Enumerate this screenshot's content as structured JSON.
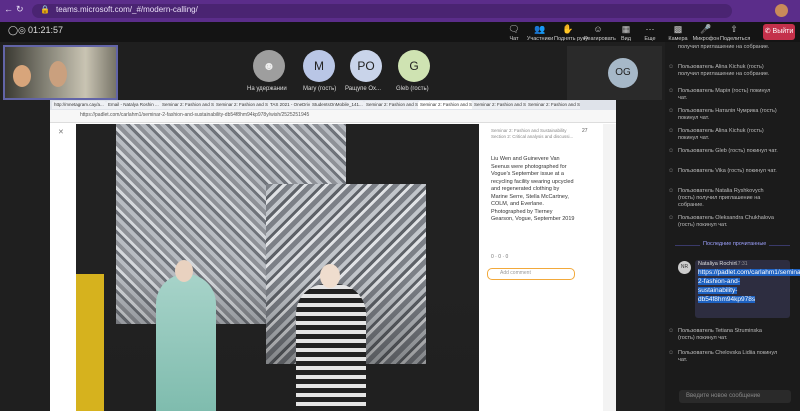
{
  "browser": {
    "url": "teams.microsoft.com/_#/modern-calling/"
  },
  "meeting": {
    "timer": "01:21:57",
    "toolbar": [
      {
        "icon": "chat-icon",
        "label": "Чат"
      },
      {
        "icon": "people-icon",
        "label": "Участники"
      },
      {
        "icon": "raise-hand-icon",
        "label": "Поднять руку"
      },
      {
        "icon": "react-icon",
        "label": "Реагировать"
      },
      {
        "icon": "view-icon",
        "label": "Вид"
      },
      {
        "icon": "more-icon",
        "label": "Еще"
      },
      {
        "icon": "camera-icon",
        "label": "Камера"
      },
      {
        "icon": "mic-icon",
        "label": "Микрофон"
      },
      {
        "icon": "share-icon",
        "label": "Поделиться"
      }
    ],
    "leave": "Выйти"
  },
  "participants": [
    {
      "initials": "",
      "name": "На удержании",
      "color": "#9e9e9e"
    },
    {
      "initials": "M",
      "name": "Mary (гость)",
      "color": "#b9c6e6"
    },
    {
      "initials": "PO",
      "name": "Ращупе Ох...",
      "color": "#c9d4ea"
    },
    {
      "initials": "G",
      "name": "Gleb (гость)",
      "color": "#cfe3b2"
    }
  ],
  "og_initials": "OG",
  "shared": {
    "tabs": [
      "http://mnetagram.cay/a...",
      "Email - Natalya Roshin ...",
      "Seminar 2: Fashion and S...",
      "Seminar 2: Fashion and S...",
      "TAS 2021 - OneDrive",
      "StudentsOnMobile_141...",
      "Seminar 2: Fashion and S...",
      "Seminar 2: Fashion and Su...",
      "Seminar 2: Fashion and Su...",
      "Seminar 2: Fashion and Su..."
    ],
    "url": "https://padlet.com/carlahm1/seminar-2-fashion-and-sustainability-db54f8hm94kp978y/wish/2525251945",
    "section": "Seminar 2: Fashion and Sustainability",
    "section2": "Section 2: Critical analysis and discussi...",
    "count": "27",
    "caption": "Liu Wen and Guinevere Van Seenus were photographed for Vogue's September issue at a recycling facility wearing upcycled and regenerated clothing by Marine Serre, Stella McCartney, COLM, and Everlane. Photographed by Tierney Gearson, Vogue, September 2019",
    "stats": "0 · 0 · 0",
    "comment_placeholder": "Add comment"
  },
  "chat": {
    "messages": [
      "получил приглашение на собрание.",
      "Пользователь Alina Kichuk (гость) получил приглашение на собрание.",
      "Пользователь Марія (гость) покинул чат.",
      "Пользователь Наталія Чумрика (гость) покинул чат.",
      "Пользователь Alina Kichuk (гость) покинул чат.",
      "Пользователь Gleb (гость) покинул чат.",
      "Пользователь Vika (гость) покинул чат.",
      "Пользователь Natalia Ryshkovych (гость) получил приглашение на собрание.",
      "Пользователь Oleksandra Chukhalova (гость) покинул чат."
    ],
    "last_read": "Последние прочитанные",
    "sender": "Nataliya Rochin",
    "time": "17:31",
    "avatar_initials": "NR",
    "link": "https://padlet.com/carlahm1/seminar-2-fashion-and-sustainability-db54f8hm94kp978s",
    "after": [
      "Пользователь Tetiana Struminska (гость) покинул чат.",
      "Пользователь Chelovska Lidiia покинул чат."
    ],
    "input_placeholder": "Введите новое сообщение"
  }
}
